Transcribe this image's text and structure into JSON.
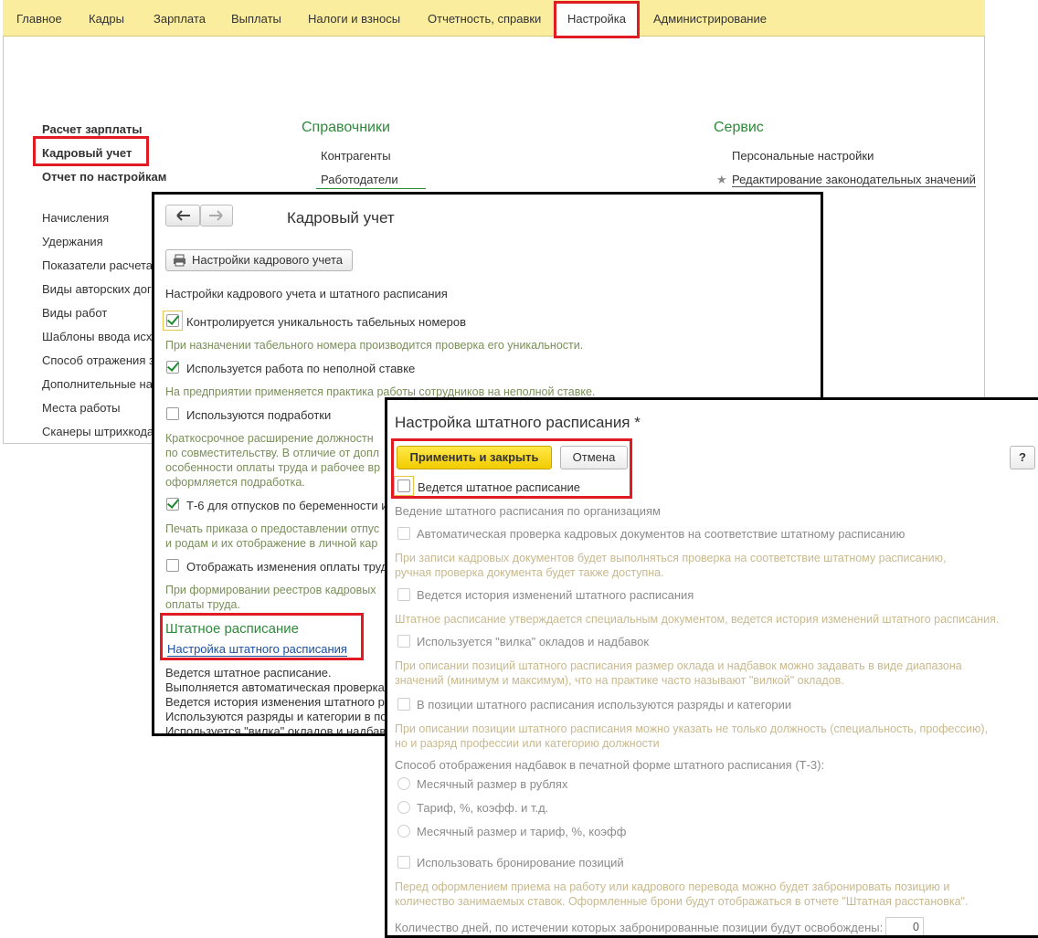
{
  "menu": {
    "items": [
      "Главное",
      "Кадры",
      "Зарплата",
      "Выплаты",
      "Налоги и взносы",
      "Отчетность, справки",
      "Настройка",
      "Администрирование"
    ],
    "active": "Настройка"
  },
  "left_panel": {
    "top_links": [
      "Расчет зарплаты",
      "Кадровый учет",
      "Отчет по настройкам"
    ],
    "links": [
      "Начисления",
      "Удержания",
      "Показатели расчета",
      "Виды авторских дог",
      "Виды работ",
      "Шаблоны ввода исх",
      "Способ отражения з",
      "Дополнительные на",
      "Места работы",
      "Сканеры штрихкода"
    ]
  },
  "references": {
    "title": "Справочники",
    "links": [
      "Контрагенты",
      "Работодатели"
    ]
  },
  "service": {
    "title": "Сервис",
    "links": [
      "Персональные настройки",
      "Редактирование законодательных значений"
    ],
    "star": "★"
  },
  "hr_window": {
    "title": "Кадровый учет",
    "back_icon": "arrow-left-icon",
    "forward_icon": "arrow-right-icon",
    "settings_button": "Настройки кадрового учета",
    "section_label": "Настройки кадрового учета и штатного расписания",
    "options": [
      {
        "label": "Контролируется уникальность табельных номеров",
        "checked": true,
        "hint": "При назначении табельного номера производится проверка его уникальности."
      },
      {
        "label": "Используется работа по неполной ставке",
        "checked": true,
        "hint": "На предприятии применяется практика работы сотрудников на неполной ставке."
      },
      {
        "label": "Используются подработки",
        "checked": false,
        "hint_lines": [
          "Краткосрочное расширение должностн",
          "по совместительству. В отличие от допл",
          "особенности оплаты труда и рабочее вр",
          "оформляется подработка."
        ]
      },
      {
        "label": "Т-6 для отпусков по беременности и",
        "checked": true,
        "hint_lines": [
          "Печать приказа о предоставлении отпус",
          "и родам и их отображение в личной кар"
        ]
      },
      {
        "label": "Отображать изменения оплаты труда",
        "checked": false,
        "hint_lines": [
          "При формировании реестров кадровых",
          "оплаты труда."
        ]
      }
    ],
    "staffing_title": "Штатное расписание",
    "staffing_link": "Настройка штатного расписания",
    "staffing_status": [
      "Ведется штатное расписание.",
      "Выполняется автоматическая проверка",
      "Ведется история изменения штатного рас",
      "Используются разряды и категории в по",
      "Используется \"вилка\" окладов и надбав"
    ]
  },
  "staffing_window": {
    "title": "Настройка штатного расписания *",
    "apply_button": "Применить и закрыть",
    "cancel_button": "Отмена",
    "help_button": "?",
    "main_checkbox": "Ведется штатное расписание",
    "org_label": "Ведение штатного расписания по организациям",
    "opt_auto_check": "Автоматическая проверка кадровых документов на соответствие штатному расписанию",
    "hint_auto_check": [
      "При записи кадровых документов будет выполняться проверка на соответствие штатному расписанию,",
      "ручная проверка документа будет также доступна."
    ],
    "opt_history": "Ведется история изменений штатного расписания",
    "hint_history": "Штатное расписание утверждается специальным документом, ведется история изменений штатного расписания.",
    "opt_fork": "Используется \"вилка\" окладов и надбавок",
    "hint_fork": [
      "При описании позиций штатного расписания размер оклада и надбавок можно задавать в виде диапазона",
      "значений (минимум и максимум), что на практике часто называют \"вилкой\" окладов."
    ],
    "opt_grades": "В позиции штатного расписания используются разряды и категории",
    "hint_grades": [
      "При описании позиции штатного расписания можно указать не только должность (специальность, профессию),",
      "но и разряд профессии или категорию должности"
    ],
    "display_label": "Способ отображения надбавок в печатной форме штатного расписания (Т-3):",
    "radio_options": [
      "Месячный размер в рублях",
      "Тариф, %, коэфф. и т.д.",
      "Месячный размер и тариф, %, коэфф"
    ],
    "opt_booking": "Использовать бронирование позиций",
    "hint_booking": [
      "Перед оформлением приема на работу или кадрового перевода можно будет забронировать позицию и",
      "количество занимаемых ставок. Оформленные брони будут отображаться в отчете \"Штатная расстановка\"."
    ],
    "days_label": "Количество дней, по истечении которых забронированные позиции будут освобождены:",
    "days_value": "0"
  },
  "colors": {
    "menu_bg": "#fbed9e",
    "highlight": "#e01b24",
    "section_green": "#2d8a3a",
    "apply_yellow": "#f2cc00"
  }
}
